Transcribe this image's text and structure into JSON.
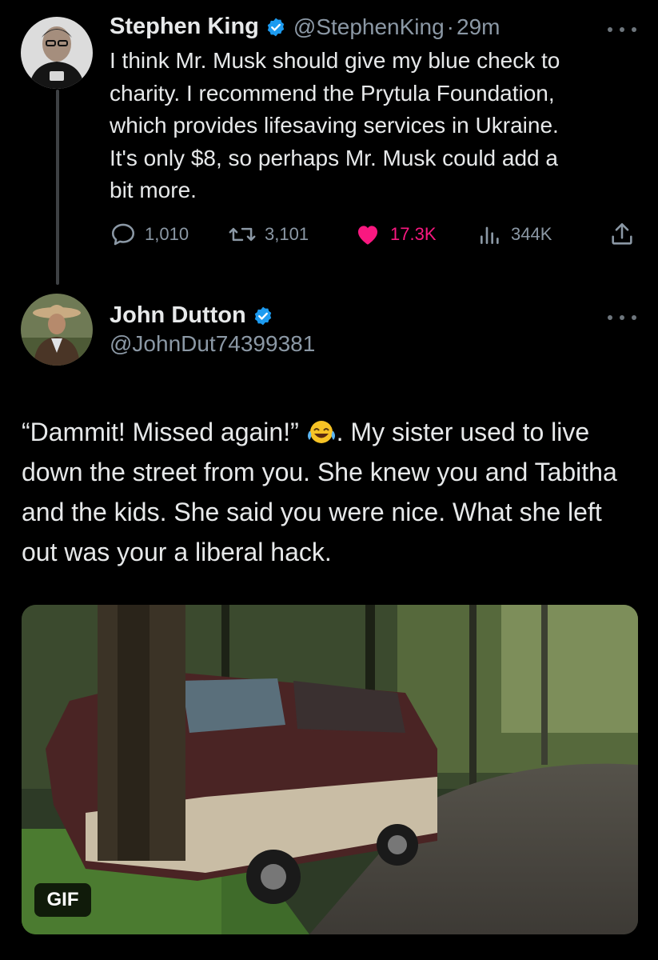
{
  "original_tweet": {
    "author_name": "Stephen King",
    "handle": "@StephenKing",
    "separator": "·",
    "time": "29m",
    "text_lines": [
      "I think Mr. Musk should give my blue check to",
      "charity. I recommend the Prytula Foundation,",
      "which provides lifesaving services in Ukraine.",
      "It's only $8, so perhaps Mr. Musk could add a",
      "bit more."
    ],
    "actions": {
      "replies": "1,010",
      "retweets": "3,101",
      "likes": "17.3K",
      "views": "344K"
    }
  },
  "reply_tweet": {
    "author_name": "John Dutton",
    "handle": "@JohnDut74399381",
    "text_before_emoji": "“Dammit! Missed again!” ",
    "text_after_emoji": ". My sister used to live down the street from you. She knew you and Tabitha and the kids. She said you were nice. What she left out was your a liberal hack.",
    "media_badge": "GIF"
  },
  "colors": {
    "background": "#000000",
    "text_primary": "#e7e9ea",
    "text_secondary": "#8b98a5",
    "verified_blue": "#1d9bf0",
    "like_pink": "#f91880"
  },
  "icons": [
    "verified-badge-icon",
    "more-options-icon",
    "reply-icon",
    "retweet-icon",
    "heart-icon",
    "views-icon",
    "share-icon",
    "laughing-emoji-icon"
  ]
}
